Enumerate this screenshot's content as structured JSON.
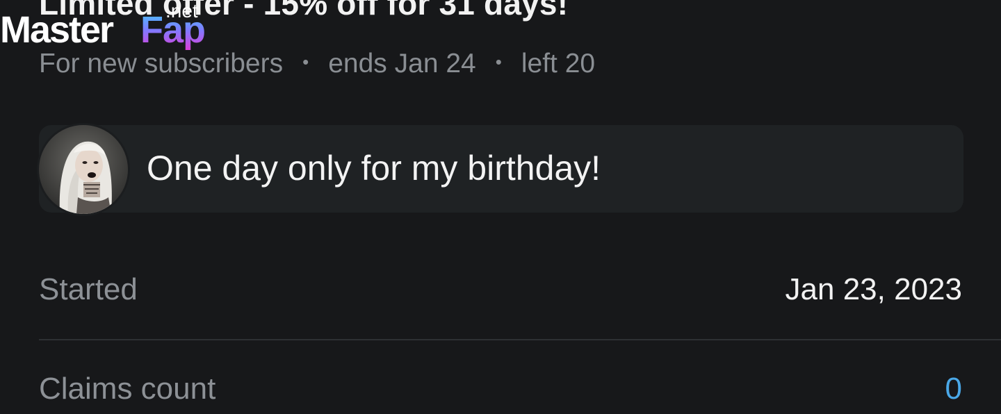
{
  "offer": {
    "title": "Limited offer - 15% off for 31 days!",
    "audience": "For new subscribers",
    "ends": "ends Jan 24",
    "left": "left 20",
    "separator": "•"
  },
  "watermark": {
    "master": "Master",
    "fap": "Fap",
    "net": ".net"
  },
  "message": {
    "text": "One day only for my birthday!",
    "avatar_icon": "user-avatar-photo"
  },
  "details": {
    "started_label": "Started",
    "started_value": "Jan 23, 2023",
    "claims_label": "Claims count",
    "claims_value": "0"
  },
  "colors": {
    "background": "#17181a",
    "card": "#1f2224",
    "muted_text": "#8a8e93",
    "primary_text": "#f2f2f2",
    "accent": "#4aa8e8"
  }
}
